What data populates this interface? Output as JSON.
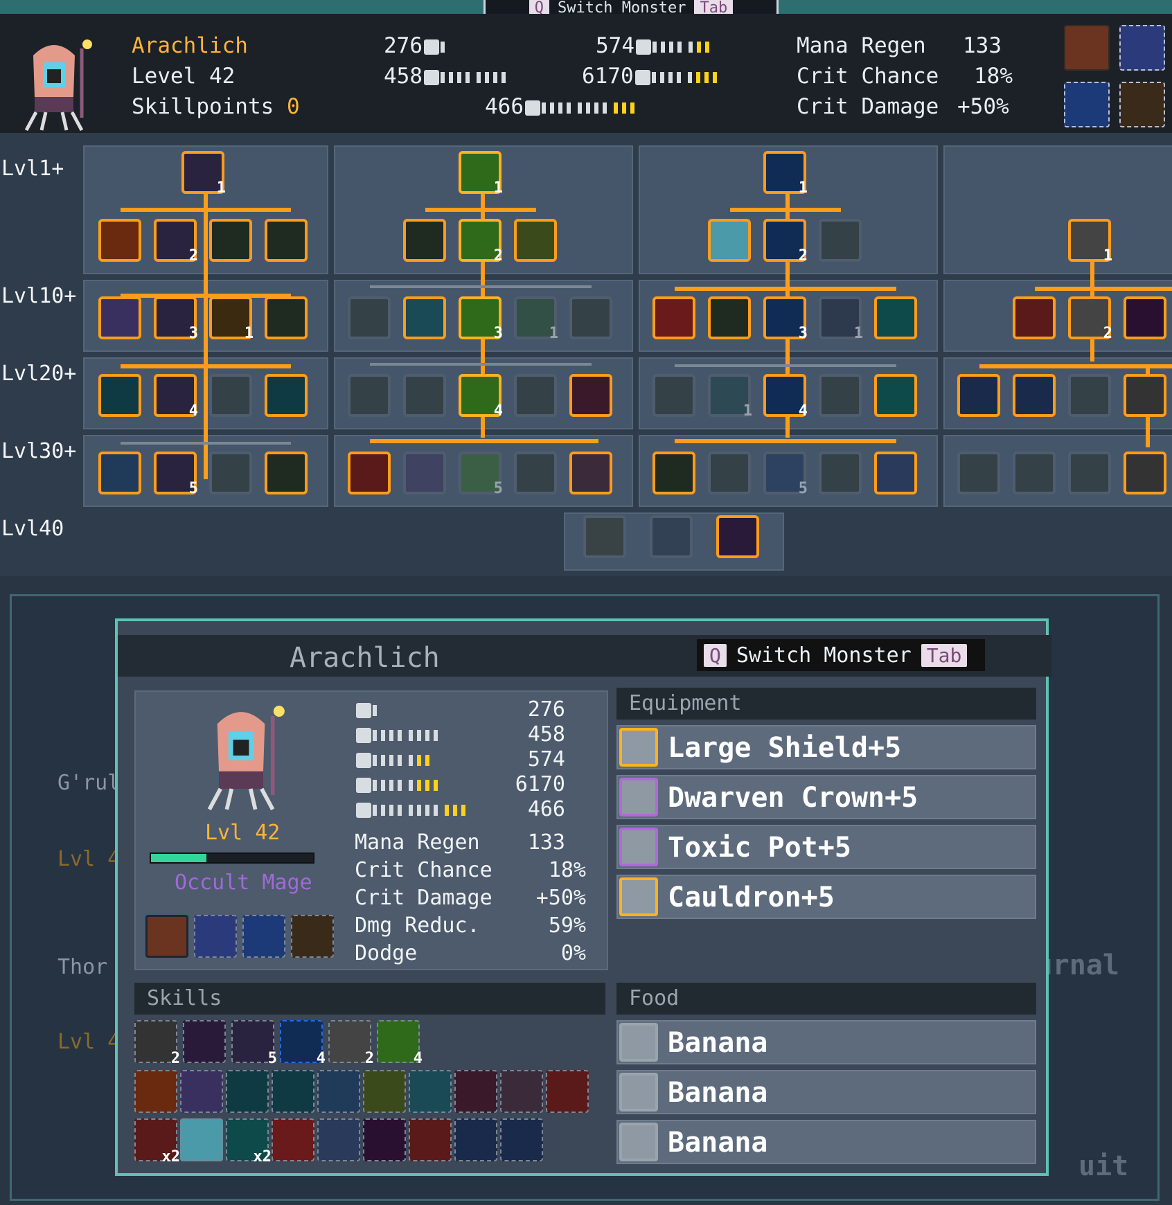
{
  "top_tab": {
    "key_left": "Q",
    "label": "Switch Monster",
    "key_right": "Tab"
  },
  "header": {
    "name": "Arachlich",
    "level": "Level 42",
    "skillpoints_label": "Skillpoints",
    "skillpoints": "0",
    "attack": "276",
    "magic": "458",
    "defense": "574",
    "health": "6170",
    "mana": "466",
    "stats": [
      {
        "label": "Mana Regen",
        "value": "133"
      },
      {
        "label": "Crit Chance",
        "value": "18%"
      },
      {
        "label": "Crit Damage",
        "value": "+50%"
      }
    ]
  },
  "tree": {
    "levels": [
      "Lvl1+",
      "Lvl10+",
      "Lvl20+",
      "Lvl30+",
      "Lvl40"
    ],
    "counts": {
      "c1r0": "1",
      "c1r1": "2",
      "c1r2": "3",
      "c1r3": "4",
      "c1r4": "5",
      "c2r0": "1",
      "c2r1": "2",
      "c2r2": "3",
      "c2r3": "4",
      "c2r4": "5",
      "c3r0": "1",
      "c3r1": "2",
      "c3r2": "3",
      "c3r3": "4",
      "c3r4": "5",
      "c4r0": "1",
      "c4r1": "2",
      "c1b": "1",
      "c2b": "1",
      "c3b": "1",
      "c3c": "1"
    }
  },
  "panel": {
    "title": "Arachlich",
    "switch_key": "Q",
    "switch_label": "Switch Monster",
    "tab_key": "Tab",
    "level": "Lvl 42",
    "class": "Occult Mage",
    "xp_fraction": 0.34,
    "stats_num": [
      "276",
      "458",
      "574",
      "6170",
      "466"
    ],
    "stats": [
      {
        "label": "Mana Regen",
        "value": "133"
      },
      {
        "label": "Crit Chance",
        "value": "18%"
      },
      {
        "label": "Crit Damage",
        "value": "+50%"
      },
      {
        "label": "Dmg Reduc.",
        "value": "59%"
      },
      {
        "label": "Dodge",
        "value": "0%"
      }
    ],
    "equipment_label": "Equipment",
    "equipment": [
      "Large Shield+5",
      "Dwarven Crown+5",
      "Toxic Pot+5",
      "Cauldron+5"
    ],
    "skills_label": "Skills",
    "skill_counts": [
      "2",
      "",
      "5",
      "4",
      "2",
      "4"
    ],
    "skill_row3_counts": [
      "x2",
      "",
      "x2"
    ],
    "food_label": "Food",
    "food": [
      "Banana",
      "Banana",
      "Banana"
    ]
  },
  "background": {
    "left_names": [
      "G'rul",
      "Thor"
    ],
    "left_levels": [
      "Lvl 4",
      "Lvl 4"
    ],
    "right_menu": "Mon. Journal",
    "right_quit": "uit"
  },
  "colors": {
    "accent": "#ff9c1a",
    "teal": "#5fc1b3",
    "name": "#ffb43a",
    "class": "#a06ad8"
  }
}
